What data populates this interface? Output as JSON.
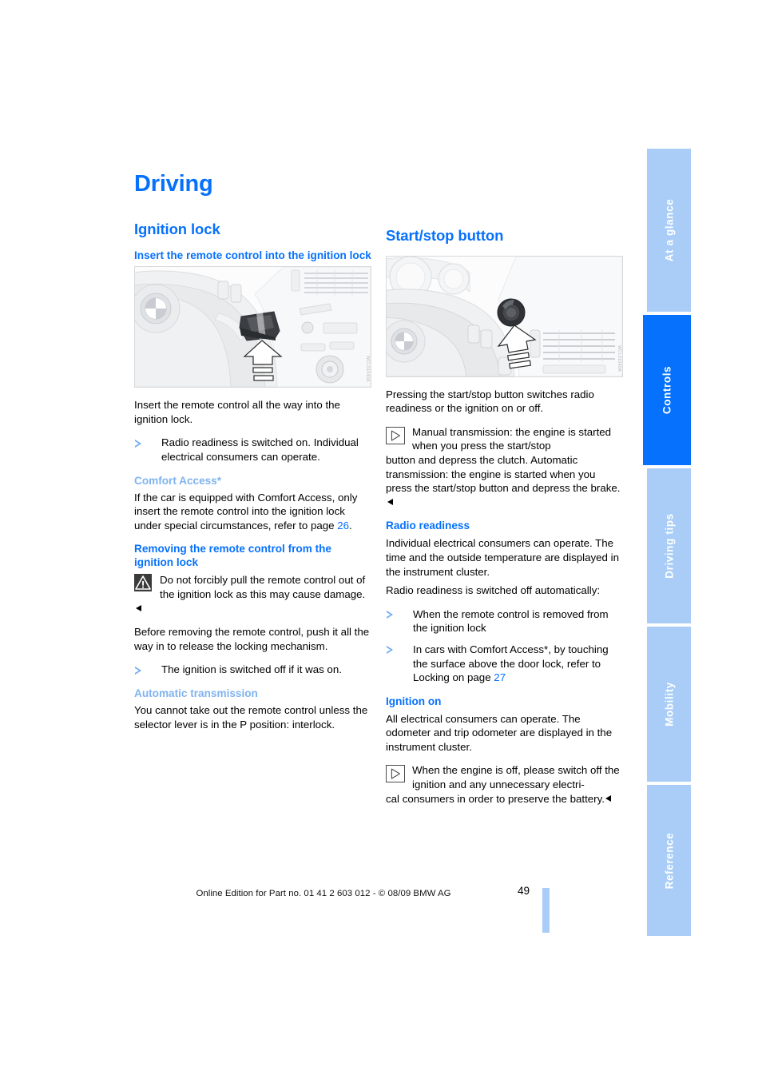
{
  "page": {
    "title": "Driving",
    "number": "49",
    "footer": "Online Edition for Part no. 01 41 2 603 012 - © 08/09 BMW AG",
    "accent_blue": "#0671fd",
    "light_blue": "#a9cdf7",
    "subheading_light_blue": "#7fb3f0"
  },
  "tabs": [
    {
      "label": "At a glance",
      "active": false
    },
    {
      "label": "Controls",
      "active": true
    },
    {
      "label": "Driving tips",
      "active": false
    },
    {
      "label": "Mobility",
      "active": false
    },
    {
      "label": "Reference",
      "active": false
    }
  ],
  "left_column": {
    "section_title": "Ignition lock",
    "insert": {
      "heading": "Insert the remote control into the ignition lock",
      "figure_code": "WCL01040A",
      "body": "Insert the remote control all the way into the ignition lock.",
      "bullets": [
        "Radio readiness is switched on. Individual electrical consumers can operate."
      ]
    },
    "comfort_access": {
      "heading": "Comfort Access*",
      "body_before": "If the car is equipped with Comfort Access, only insert the remote control into the ignition lock under special circumstances, refer to page ",
      "page_link": "26",
      "body_after": "."
    },
    "removing": {
      "heading": "Removing the remote control from the ignition lock",
      "warning": "Do not forcibly pull the remote control out of the ignition lock as this may cause damage.",
      "body": "Before removing the remote control, push it all the way in to release the locking mechanism.",
      "bullets": [
        "The ignition is switched off if it was on."
      ]
    },
    "automatic_transmission": {
      "heading": "Automatic transmission",
      "body": "You cannot take out the remote control unless the selector lever is in the P position: interlock."
    }
  },
  "right_column": {
    "section_title": "Start/stop button",
    "figure_code": "WCL01040A",
    "intro": "Pressing the start/stop button switches radio readiness or the ignition on or off.",
    "note": {
      "indented": "Manual transmission: the engine is started when you press the start/stop",
      "rest": "button and depress the clutch. Automatic transmission: the engine is started when you press the start/stop button and depress the brake."
    },
    "radio_readiness": {
      "heading": "Radio readiness",
      "body1": "Individual electrical consumers can operate. The time and the outside temperature are displayed in the instrument cluster.",
      "body2": "Radio readiness is switched off automatically:",
      "bullets": [
        {
          "text": "When the remote control is removed from the ignition lock"
        },
        {
          "text_before": "In cars with Comfort Access*, by touching the surface above the door lock, refer to Locking on page ",
          "page_link": "27"
        }
      ]
    },
    "ignition_on": {
      "heading": "Ignition on",
      "body": "All electrical consumers can operate. The odometer and trip odometer are displayed in the instrument cluster.",
      "note_indented": "When the engine is off, please switch off the ignition and any unnecessary electri-",
      "note_rest": "cal consumers in order to preserve the battery."
    }
  }
}
